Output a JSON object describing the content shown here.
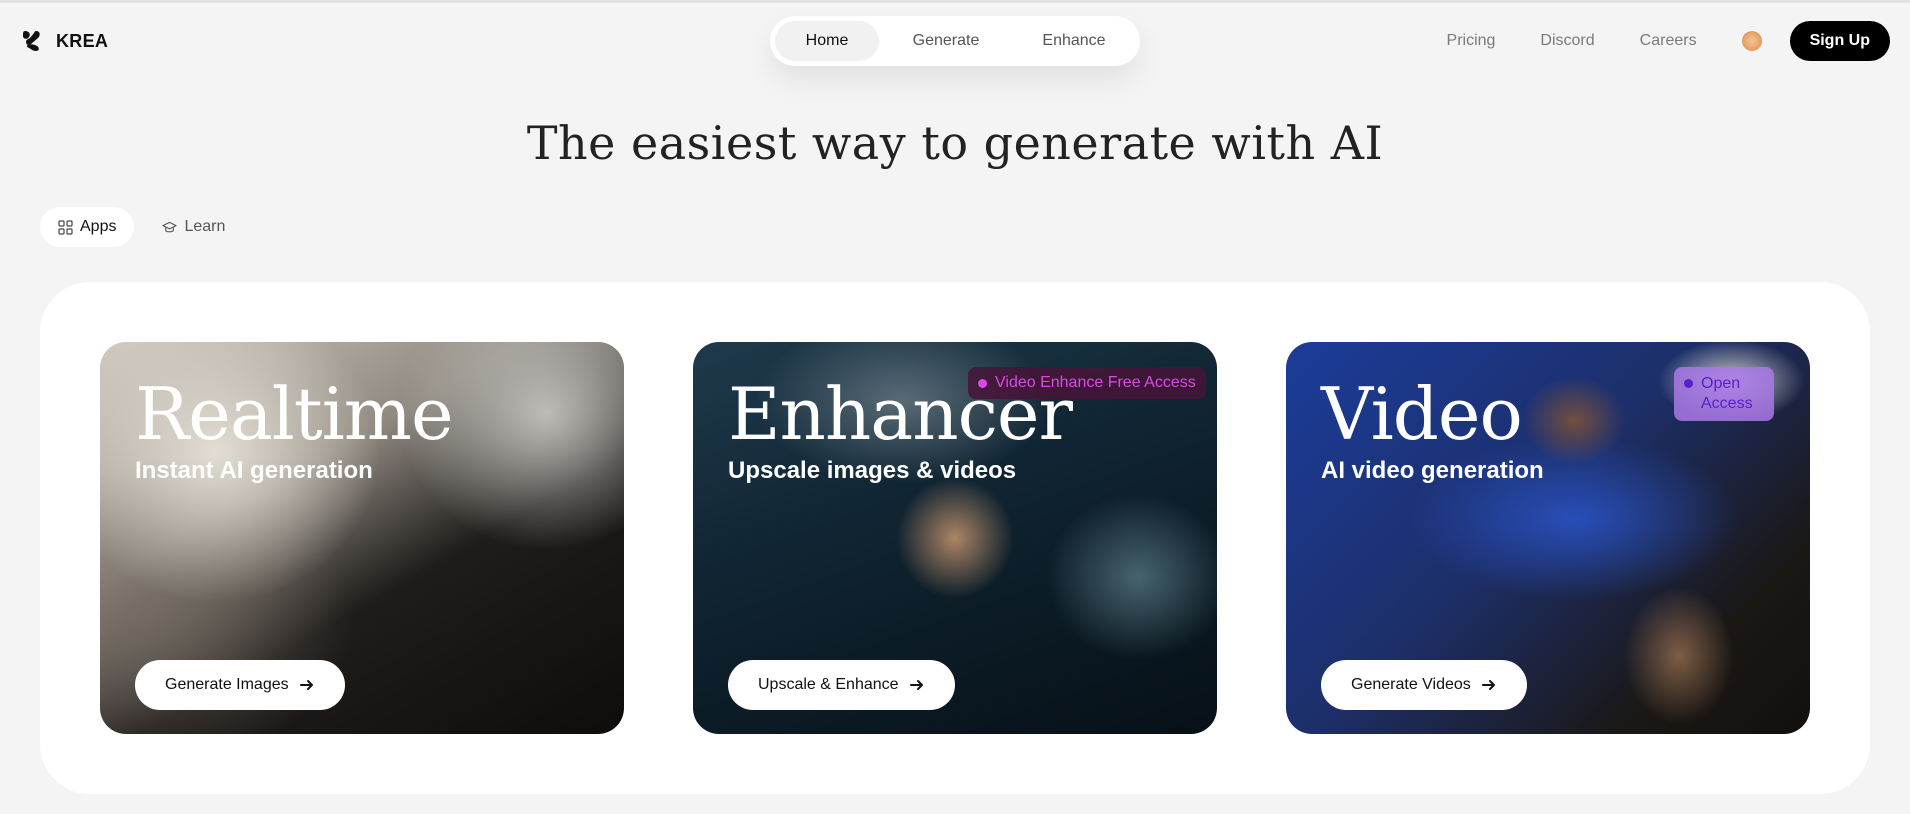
{
  "brand": {
    "name": "KREA"
  },
  "nav": {
    "tabs": [
      {
        "label": "Home",
        "active": true
      },
      {
        "label": "Generate",
        "active": false
      },
      {
        "label": "Enhance",
        "active": false
      }
    ]
  },
  "header": {
    "links": [
      "Pricing",
      "Discord",
      "Careers"
    ],
    "signup_label": "Sign Up"
  },
  "hero": {
    "headline": "The easiest way to generate with AI"
  },
  "segments": {
    "apps": {
      "label": "Apps",
      "icon": "grid-icon"
    },
    "learn": {
      "label": "Learn",
      "icon": "graduation-cap-icon"
    }
  },
  "cards": [
    {
      "title": "Realtime",
      "subtitle": "Instant AI generation",
      "button": "Generate Images",
      "badge": ""
    },
    {
      "title": "Enhancer",
      "subtitle": "Upscale images & videos",
      "button": "Upscale & Enhance",
      "badge": "Video Enhance Free Access",
      "badge_color": "#c13ad6"
    },
    {
      "title": "Video",
      "subtitle": "AI video generation",
      "button": "Generate Videos",
      "badge": "Open Access",
      "badge_color": "#6a2bd8"
    }
  ]
}
